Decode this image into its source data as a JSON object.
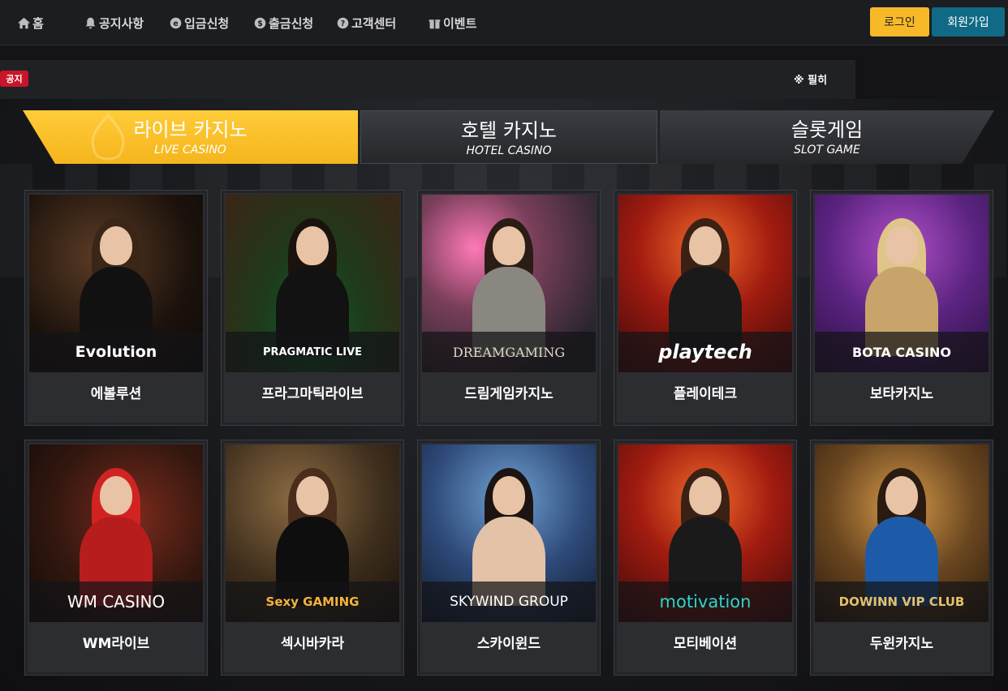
{
  "header": {
    "nav": [
      {
        "label": "홈",
        "icon": "home-icon"
      },
      {
        "label": "공지사항",
        "icon": "bell-icon"
      },
      {
        "label": "입금신청",
        "icon": "coin-deposit-icon"
      },
      {
        "label": "출금신청",
        "icon": "coin-withdraw-icon"
      },
      {
        "label": "고객센터",
        "icon": "help-icon"
      },
      {
        "label": "이벤트",
        "icon": "gift-icon"
      }
    ],
    "login_label": "로그인",
    "join_label": "회원가입",
    "colors": {
      "login": "#f8b928",
      "join": "#106a86"
    }
  },
  "notice": {
    "badge": "공지",
    "text": "※ 필히"
  },
  "tabs": [
    {
      "ko": "라이브 카지노",
      "en": "LIVE CASINO",
      "active": true
    },
    {
      "ko": "호텔 카지노",
      "en": "HOTEL CASINO",
      "active": false
    },
    {
      "ko": "슬롯게임",
      "en": "SLOT GAME",
      "active": false
    }
  ],
  "games": [
    {
      "name": "에볼루션",
      "logo": "Evolution"
    },
    {
      "name": "프라그마틱라이브",
      "logo": "PRAGMATIC LIVE"
    },
    {
      "name": "드림게임카지노",
      "logo": "DREAMGAMING"
    },
    {
      "name": "플레이테크",
      "logo": "playtech"
    },
    {
      "name": "보타카지노",
      "logo": "BOTA CASINO"
    },
    {
      "name": "WM라이브",
      "logo": "WM CASINO"
    },
    {
      "name": "섹시바카라",
      "logo": "Sexy GAMING"
    },
    {
      "name": "스카이윈드",
      "logo": "SKYWIND GROUP"
    },
    {
      "name": "모티베이션",
      "logo": "motivation"
    },
    {
      "name": "두윈카지노",
      "logo": "DOWINN VIP CLUB"
    }
  ]
}
